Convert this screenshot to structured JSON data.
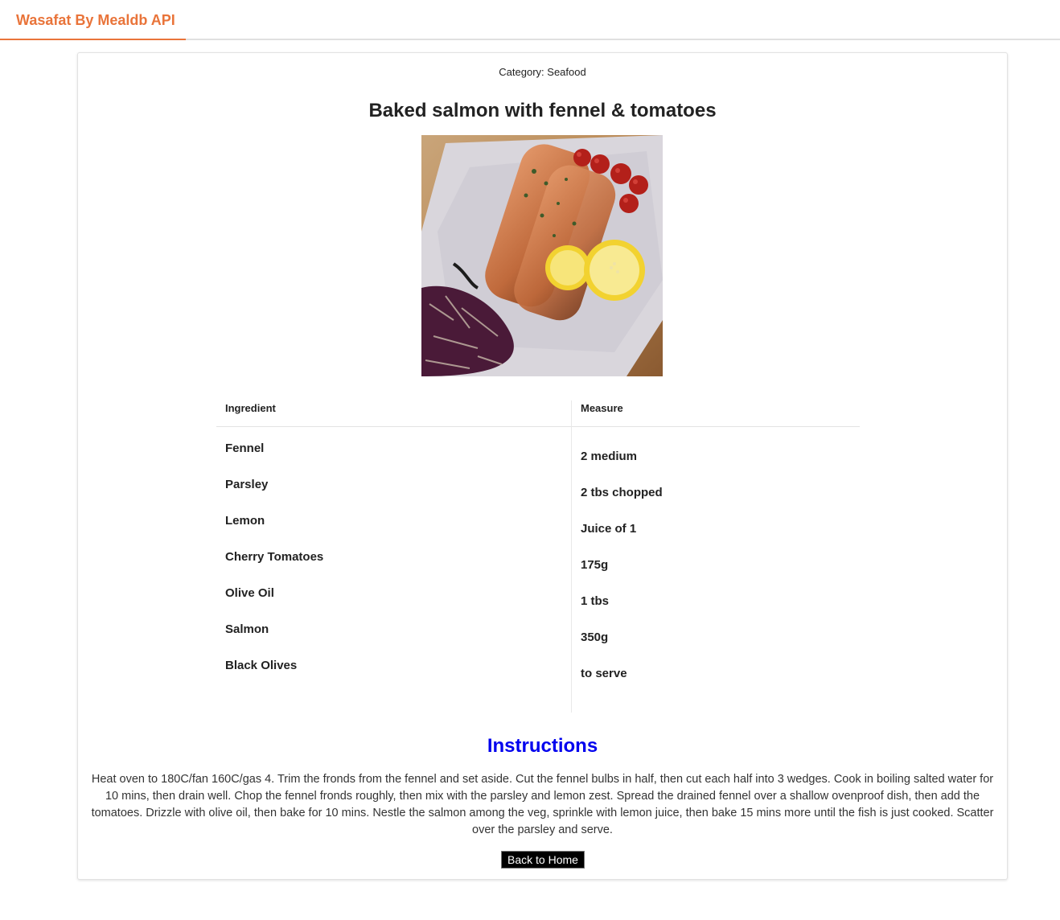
{
  "header": {
    "brand": "Wasafat By Mealdb API"
  },
  "meal": {
    "category_label": "Category: Seafood",
    "title": "Baked salmon with fennel & tomatoes",
    "image_alt": "Baked salmon with fennel & tomatoes"
  },
  "table": {
    "headers": {
      "ingredient": "Ingredient",
      "measure": "Measure"
    },
    "ingredients": [
      "Fennel",
      "Parsley",
      "Lemon",
      "Cherry Tomatoes",
      "Olive Oil",
      "Salmon",
      "Black Olives"
    ],
    "measures": [
      "2 medium",
      "2 tbs chopped",
      "Juice of 1",
      "175g",
      "1 tbs",
      "350g",
      "to serve"
    ]
  },
  "instructions": {
    "title": "Instructions",
    "text": "Heat oven to 180C/fan 160C/gas 4. Trim the fronds from the fennel and set aside. Cut the fennel bulbs in half, then cut each half into 3 wedges. Cook in boiling salted water for 10 mins, then drain well. Chop the fennel fronds roughly, then mix with the parsley and lemon zest. Spread the drained fennel over a shallow ovenproof dish, then add the tomatoes. Drizzle with olive oil, then bake for 10 mins. Nestle the salmon among the veg, sprinkle with lemon juice, then bake 15 mins more until the fish is just cooked. Scatter over the parsley and serve."
  },
  "actions": {
    "back_label": "Back to Home"
  },
  "colors": {
    "brand": "#e9743a",
    "instructions_title": "#0000ee",
    "button_bg": "#000000"
  }
}
